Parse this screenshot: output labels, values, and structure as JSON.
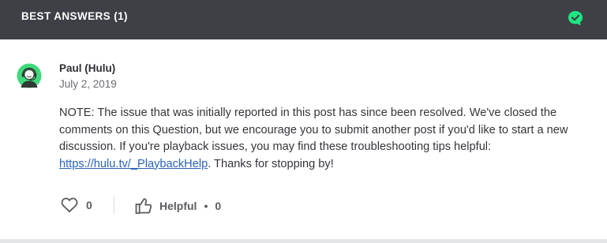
{
  "header": {
    "title": "BEST ANSWERS (1)",
    "badge_icon": "check-bubble-icon",
    "badge_color": "#1ce783"
  },
  "post": {
    "author": "Paul (Hulu)",
    "date": "July 2, 2019",
    "avatar_icon": "headset-agent-avatar",
    "avatar_color": "#3fd97b",
    "body_part1": "NOTE: The issue that was initially reported in this post has since been resolved. We've closed the comments on this Question, but we encourage you to submit another post if you'd like to start a new discussion. If you're playback issues, you may find these troubleshooting tips helpful: ",
    "link_text": "https://hulu.tv/_PlaybackHelp",
    "body_part2": ". Thanks for stopping by!"
  },
  "actions": {
    "like_icon": "heart-icon",
    "like_count": "0",
    "helpful_icon": "thumbs-up-icon",
    "helpful_label": "Helpful",
    "helpful_separator": "•",
    "helpful_count": "0"
  }
}
